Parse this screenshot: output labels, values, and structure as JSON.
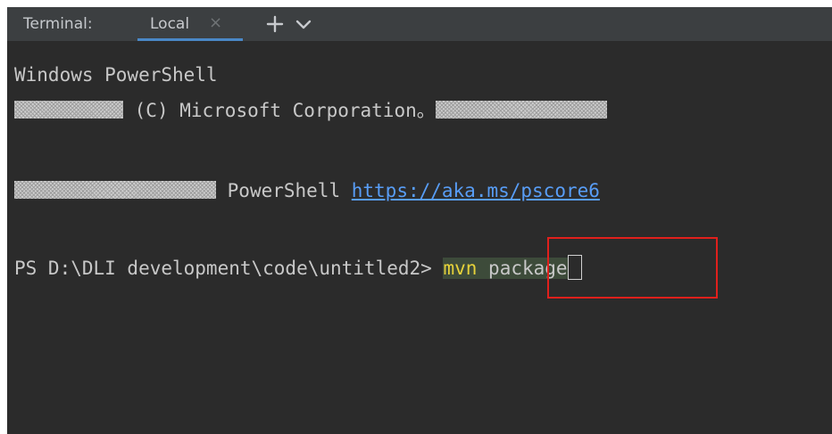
{
  "header": {
    "title": "Terminal:",
    "tab_label": "Local",
    "close_glyph": "×",
    "add_icon": "plus-icon",
    "dropdown_icon": "chevron-down-icon"
  },
  "lines": {
    "line1": "Windows PowerShell",
    "line2_text": "(C) Microsoft Corporation。",
    "line3_text": "PowerShell",
    "line3_link": "https://aka.ms/pscore6",
    "prompt": "PS D:\\DLI development\\code\\untitled2>",
    "command_word": "mvn",
    "command_args": "package"
  },
  "colors": {
    "background": "#2b2b2b",
    "tab_bar": "#3c3f41",
    "link": "#589df6",
    "command": "#e6d23a",
    "highlight_border": "#e0201c"
  }
}
